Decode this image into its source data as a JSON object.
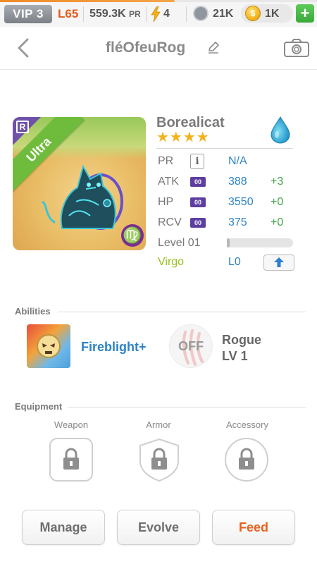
{
  "status_bar": {
    "vip": "VIP 3",
    "level": "L65",
    "power": "559.3K",
    "power_unit": "PR",
    "energy": "4",
    "paw_tokens": "21K",
    "coins": "1K",
    "add_label": "+"
  },
  "header": {
    "title": "fléOfeuRog"
  },
  "creature": {
    "name": "Borealicat",
    "stars": "★★★★",
    "rarity_badge": "R",
    "rarity": "Ultra",
    "zodiac_symbol": "♍",
    "stats": [
      {
        "label": "PR",
        "value": "N/A",
        "bonus": ""
      },
      {
        "label": "ATK",
        "box": "00",
        "value": "388",
        "bonus": "+3"
      },
      {
        "label": "HP",
        "box": "00",
        "value": "3550",
        "bonus": "+0"
      },
      {
        "label": "RCV",
        "box": "00",
        "value": "375",
        "bonus": "+0"
      }
    ],
    "level_label": "Level 01",
    "level_progress": 0.02,
    "zodiac": "Virgo",
    "zodiac_level": "L0",
    "info_glyph": "i"
  },
  "abilities": {
    "heading": "Abilities",
    "primary_name": "Fireblight+",
    "secondary_state": "OFF",
    "secondary_name": "Rogue",
    "secondary_level": "LV 1"
  },
  "equipment": {
    "heading": "Equipment",
    "slots": [
      "Weapon",
      "Armor",
      "Accessory"
    ]
  },
  "actions": {
    "manage": "Manage",
    "evolve": "Evolve",
    "feed": "Feed"
  },
  "colors": {
    "accent_orange": "#e8611f",
    "blue_value": "#2d83c7",
    "green_bonus": "#43a44a",
    "virgo_green": "#96c11f",
    "ultra_ribbon": "#6fbc3c"
  }
}
